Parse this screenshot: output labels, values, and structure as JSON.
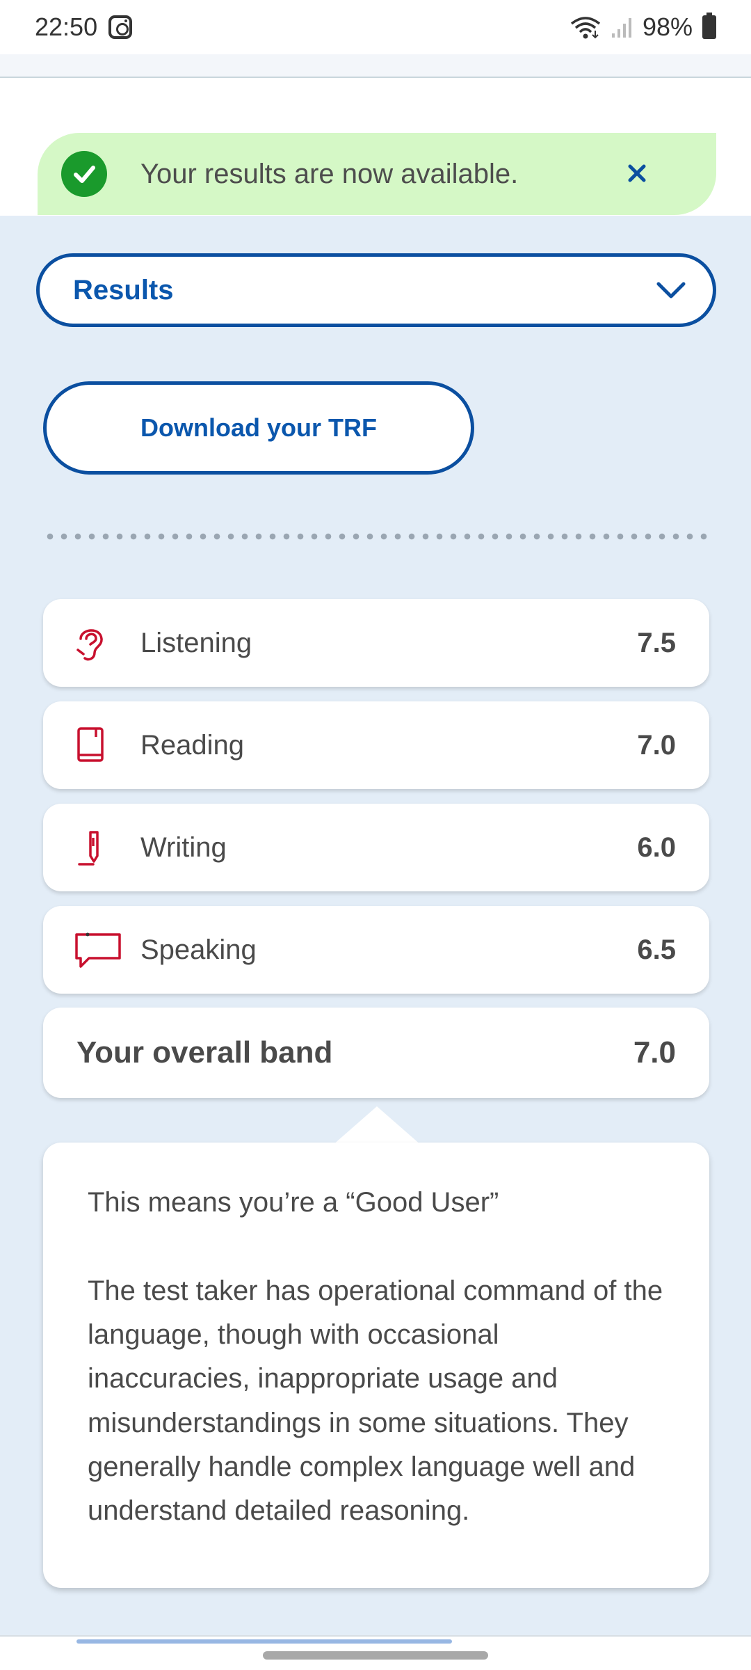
{
  "status_bar": {
    "time": "22:50",
    "battery": "98%",
    "icons": [
      "instagram-icon",
      "wifi-icon",
      "signal-icon",
      "battery-icon"
    ]
  },
  "notification": {
    "message": "Your results are now available.",
    "icon": "check-circle-icon",
    "close_icon": "close-icon",
    "colors": {
      "background": "#d5f8c6",
      "check": "#1a9a2c",
      "close": "#0b4fa0"
    }
  },
  "results_select": {
    "selected": "Results",
    "icon": "chevron-down-icon"
  },
  "download": {
    "label": "Download your TRF"
  },
  "scores": [
    {
      "name": "Listening",
      "value": "7.5",
      "icon": "ear-icon"
    },
    {
      "name": "Reading",
      "value": "7.0",
      "icon": "book-icon"
    },
    {
      "name": "Writing",
      "value": "6.0",
      "icon": "pen-icon"
    },
    {
      "name": "Speaking",
      "value": "6.5",
      "icon": "speech-bubble-icon"
    }
  ],
  "overall": {
    "label": "Your overall band",
    "value": "7.0"
  },
  "description": {
    "heading": "This means you’re a “Good User”",
    "body": "The test taker has operational command of the language, though with occasional inaccuracies, inappropriate usage and misunderstandings in some situations. They generally handle complex language well and understand detailed reasoning."
  },
  "colors": {
    "accent_blue": "#0b4fa0",
    "icon_red": "#c8102e",
    "page_background": "#e3edf7"
  }
}
